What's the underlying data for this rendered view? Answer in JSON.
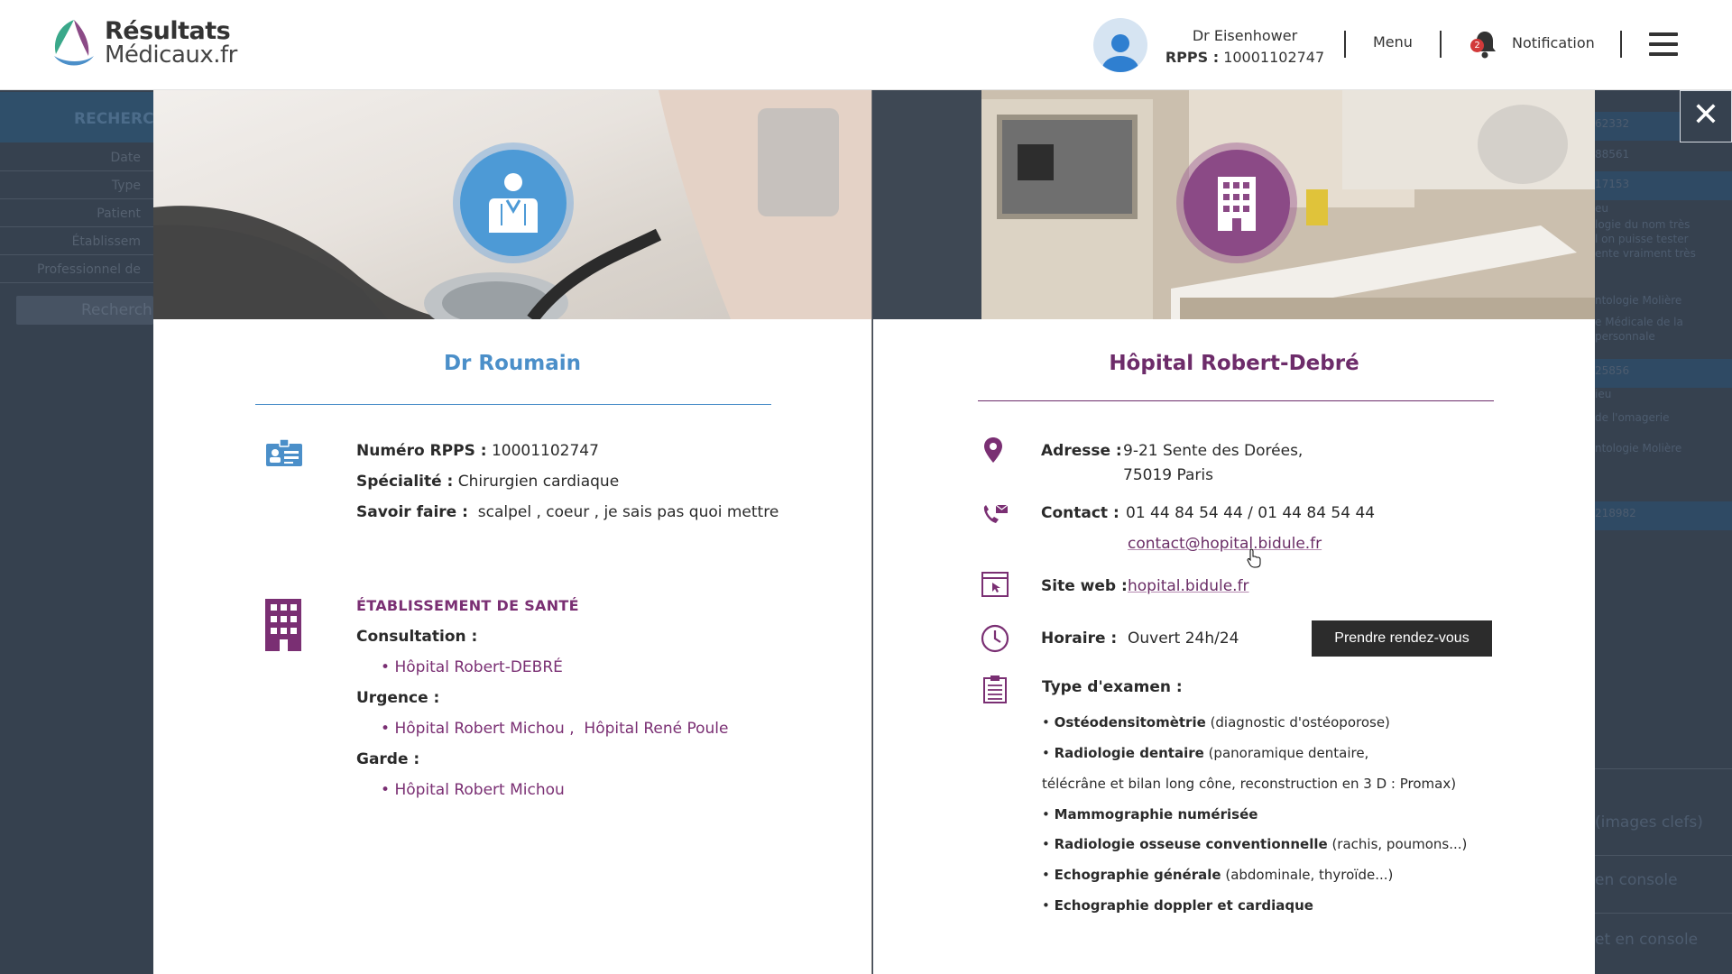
{
  "header": {
    "logo_line1": "Résultats",
    "logo_line2": "Médicaux.fr",
    "user_name": "Dr  Eisenhower",
    "rpps_label": "RPPS :",
    "rpps_value": "10001102747",
    "menu_label": "Menu",
    "notification_count": "2",
    "notification_label": "Notification"
  },
  "background": {
    "search_title": "RECHERC",
    "filters": [
      "Date",
      "Type",
      "Patient",
      "Établissem",
      "Professionnel de"
    ],
    "search_button": "Recherch",
    "right_items": [
      "62332",
      "88561",
      "17153",
      "eu",
      "logie du nom très",
      "l on puisse tester",
      "ente vraiment très",
      "ntologie Molière",
      "e Médicale de la",
      "personnale",
      "25856",
      "ieu",
      "de l'omagerie",
      "ntologie Molière",
      "218982",
      "(images clefs)",
      "en console",
      "et en console"
    ]
  },
  "close_label": "✕",
  "doctor": {
    "name": "Dr Roumain",
    "rpps_label": "Numéro RPPS :",
    "rpps_value": "10001102747",
    "specialty_label": "Spécialité :",
    "specialty_value": "Chirurgien cardiaque",
    "skills_label": "Savoir faire :",
    "skills_value": "scalpel , coeur , je sais pas quoi mettre",
    "establishment_heading": "ÉTABLISSEMENT DE SANTÉ",
    "consultation_label": "Consultation :",
    "consultation_items": [
      "Hôpital Robert-DEBRÉ"
    ],
    "urgence_label": "Urgence :",
    "urgence_items": [
      "Hôpital Robert Michou ,",
      "Hôpital René Poule"
    ],
    "garde_label": "Garde :",
    "garde_items": [
      "Hôpital Robert Michou"
    ]
  },
  "hospital": {
    "name": "Hôpital Robert-Debré",
    "address_label": "Adresse :",
    "address_line1": "9-21 Sente des Dorées,",
    "address_line2": "75019 Paris",
    "contact_label": "Contact :",
    "contact_phones": "01 44 84 54 44 / 01 44 84 54 44",
    "contact_email": "contact@hopital.bidule.fr",
    "website_label": "Site web :",
    "website_value": "hopital.bidule.fr",
    "hours_label": "Horaire :",
    "hours_value": "Ouvert 24h/24",
    "appointment_button": "Prendre rendez-vous",
    "exam_label": "Type d'examen :",
    "exams": [
      {
        "name": "Ostéodensitomètrie",
        "detail": "(diagnostic d'ostéoporose)"
      },
      {
        "name": "Radiologie dentaire",
        "detail": "(panoramique dentaire,"
      },
      {
        "name": "",
        "detail": "télécrâne et bilan long cône, reconstruction en 3 D : Promax)"
      },
      {
        "name": "Mammographie numérisée",
        "detail": ""
      },
      {
        "name": "Radiologie osseuse conventionnelle",
        "detail": "(rachis, poumons...)"
      },
      {
        "name": "Echographie générale",
        "detail": "(abdominale, thyroïde...)"
      },
      {
        "name": "Echographie doppler et cardiaque",
        "detail": ""
      }
    ]
  },
  "colors": {
    "doctor_accent": "#4b8fc9",
    "hospital_accent": "#6d2c6a",
    "overlay": "#3a4452"
  }
}
